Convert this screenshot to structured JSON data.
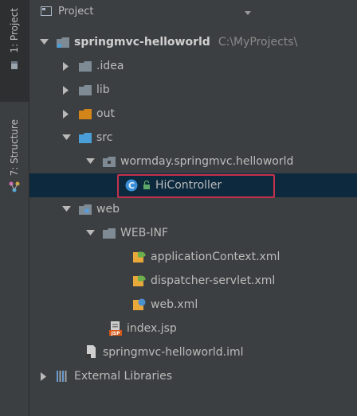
{
  "sidebar": {
    "project_tab": "1: Project",
    "structure_tab": "7: Structure"
  },
  "header": {
    "title": "Project"
  },
  "tree": {
    "root": {
      "label": "springmvc-helloworld",
      "path": "C:\\MyProjects\\"
    },
    "idea": "idea",
    "lib": "lib",
    "out": "out",
    "src": "src",
    "package": "wormday.springmvc.helloworld",
    "controller": "HiController",
    "web": "web",
    "webinf": "WEB-INF",
    "appctx": "applicationContext.xml",
    "dispatcher": "dispatcher-servlet.xml",
    "webxml": "web.xml",
    "index": "index.jsp",
    "iml": "springmvc-helloworld.iml",
    "external": "External Libraries"
  },
  "colors": {
    "folder": "#7e8a94",
    "src_folder": "#4a9fd8",
    "out_folder": "#d4851a",
    "web_folder": "#5a9bd6",
    "class_icon": "#3a8fd6",
    "selection": "#0d293e",
    "highlight_border": "#c4314b"
  }
}
